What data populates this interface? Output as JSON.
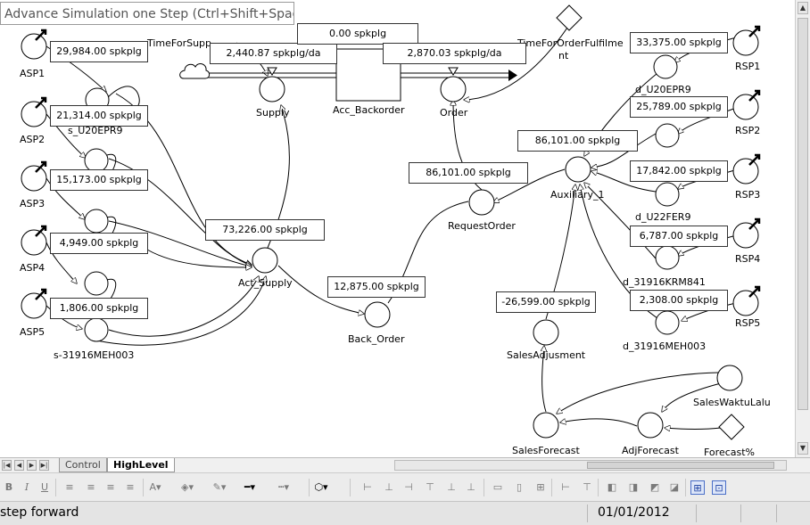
{
  "tooltip": "Advance Simulation one Step (Ctrl+Shift+Space)",
  "values": {
    "asp1": "29,984.00 spkplg",
    "asp2": "21,314.00 spkplg",
    "asp3": "15,173.00 spkplg",
    "asp4": "4,949.00 spkplg",
    "asp5": "1,806.00 spkplg",
    "supply": "2,440.87 spkplg/da",
    "backorder_top": "0.00 spkplg",
    "order": "2,870.03 spkplg/da",
    "act_supply": "73,226.00 spkplg",
    "request_order": "86,101.00 spkplg",
    "auxiliary": "86,101.00 spkplg",
    "back_order": "12,875.00 spkplg",
    "rsp1": "33,375.00 spkplg",
    "rsp2": "25,789.00 spkplg",
    "rsp3": "17,842.00 spkplg",
    "rsp4": "6,787.00 spkplg",
    "rsp5": "2,308.00 spkplg",
    "sales_adjusment": "-26,599.00 spkplg"
  },
  "labels": {
    "asp1": "ASP1",
    "asp2": "ASP2",
    "asp3": "ASP3",
    "asp4": "ASP4",
    "asp5": "ASP5",
    "s_u20epr9": "s_U20EPR9",
    "s_31916meh003": "s-31916MEH003",
    "time_for_supply": "TimeForSupp",
    "supply": "Supply",
    "acc_backorder": "Acc_Backorder",
    "order": "Order",
    "time_for_order_1": "TimeForOrderFulfilme",
    "time_for_order_2": "nt",
    "act_supply": "Act_Supply",
    "request_order": "RequestOrder",
    "auxiliary": "Auxiliary_1",
    "back_order": "Back_Order",
    "rsp1": "RSP1",
    "rsp2": "RSP2",
    "rsp3": "RSP3",
    "rsp4": "RSP4",
    "rsp5": "RSP5",
    "d_u20epr9": "d_U20EPR9",
    "d_u22fer9": "d_U22FER9",
    "d_31916krm841": "d_31916KRM841",
    "d_31916meh003": "d_31916MEH003",
    "sales_adjusment": "SalesAdjusment",
    "sales_forecast": "SalesForecast",
    "adj_forecast": "AdjForecast",
    "sales_waktu_lalu": "SalesWaktuLalu",
    "forecast_pct": "Forecast%"
  },
  "tabs": [
    {
      "label": "Control",
      "active": false
    },
    {
      "label": "HighLevel",
      "active": true
    }
  ],
  "toolbar_icons": [
    "bold-icon",
    "italic-icon",
    "underline-icon",
    "align-left-icon",
    "align-center-icon",
    "align-right-icon",
    "justify-icon",
    "font-color-icon",
    "fill-color-icon",
    "line-color-icon",
    "line-width-icon",
    "line-style-icon",
    "shape-icon",
    "align-objects-icons",
    "group-icons",
    "grid-icon",
    "snap-icon"
  ],
  "status": {
    "left": "step forward",
    "date": "01/01/2012"
  }
}
